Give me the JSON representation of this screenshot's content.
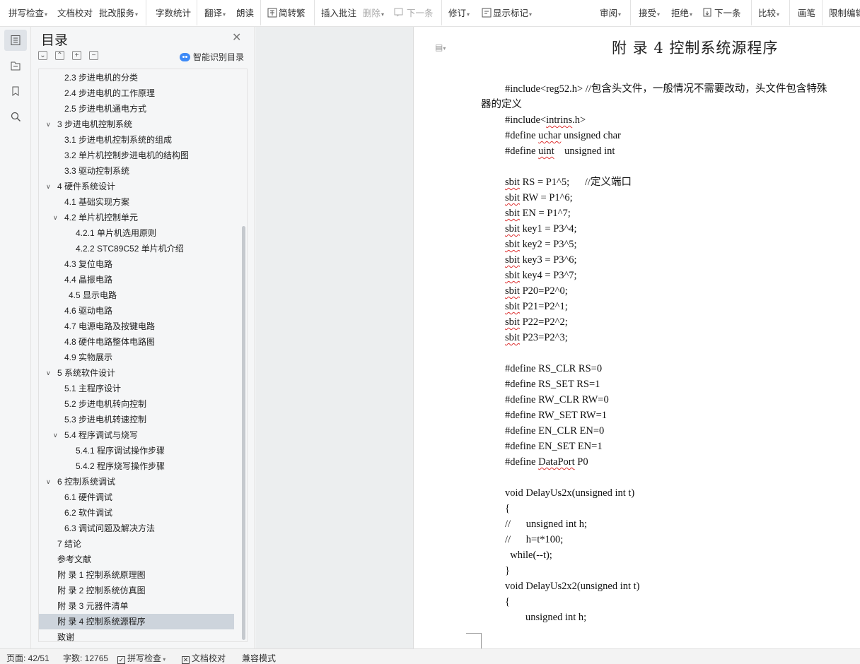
{
  "ribbon": {
    "spell_check": "拼写检查",
    "doc_proofread": "文档校对",
    "review_service": "批改服务",
    "word_count": "字数统计",
    "translate": "翻译",
    "read_aloud": "朗读",
    "simp_trad": "简转繁",
    "insert_comment": "插入批注",
    "delete": "删除",
    "next_comment": "下一条",
    "track_changes": "修订",
    "show_markup": "显示标记",
    "review": "审阅",
    "accept": "接受",
    "reject": "拒绝",
    "next_change": "下一条",
    "compare": "比较",
    "ink": "画笔",
    "restrict_editing": "限制编辑"
  },
  "toc": {
    "title": "目录",
    "smart_identify": "智能识别目录",
    "items": [
      {
        "label": "2.3  步进电机的分类",
        "level": 2
      },
      {
        "label": "2.4  步进电机的工作原理",
        "level": 2
      },
      {
        "label": "2.5  步进电机通电方式",
        "level": 2
      },
      {
        "label": "3    步进电机控制系统",
        "level": 1,
        "expanded": true
      },
      {
        "label": "3.1  步进电机控制系统的组成",
        "level": 2
      },
      {
        "label": "3.2 单片机控制步进电机的结构图",
        "level": 2
      },
      {
        "label": "3.3  驱动控制系统",
        "level": 2
      },
      {
        "label": "4    硬件系统设计",
        "level": 1,
        "expanded": true
      },
      {
        "label": "4.1  基础实现方案",
        "level": 2
      },
      {
        "label": "4.2  单片机控制单元",
        "level": 2,
        "expanded": true
      },
      {
        "label": "4.2.1  单片机选用原则",
        "level": 3
      },
      {
        "label": "4.2.2 STC89C52 单片机介绍",
        "level": 3
      },
      {
        "label": "4.3  复位电路",
        "level": 2
      },
      {
        "label": "4.4  晶振电路",
        "level": 2
      },
      {
        "label": "4.5  显示电路",
        "level": 2,
        "indent_extra": true
      },
      {
        "label": "4.6  驱动电路",
        "level": 2
      },
      {
        "label": "4.7  电源电路及按键电路",
        "level": 2
      },
      {
        "label": "4.8  硬件电路整体电路图",
        "level": 2
      },
      {
        "label": "4.9  实物展示",
        "level": 2
      },
      {
        "label": "5    系统软件设计",
        "level": 1,
        "expanded": true
      },
      {
        "label": "5.1  主程序设计",
        "level": 2
      },
      {
        "label": "5.2  步进电机转向控制",
        "level": 2
      },
      {
        "label": "5.3  步进电机转速控制",
        "level": 2
      },
      {
        "label": "5.4  程序调试与烧写",
        "level": 2,
        "expanded": true
      },
      {
        "label": "5.4.1  程序调试操作步骤",
        "level": 3
      },
      {
        "label": "5.4.2  程序烧写操作步骤",
        "level": 3
      },
      {
        "label": "6    控制系统调试",
        "level": 1,
        "expanded": true
      },
      {
        "label": "6.1  硬件调试",
        "level": 2
      },
      {
        "label": "6.2  软件调试",
        "level": 2
      },
      {
        "label": "6.3  调试问题及解决方法",
        "level": 2
      },
      {
        "label": "7    结论",
        "level": 1
      },
      {
        "label": "参考文献",
        "level": 1
      },
      {
        "label": "附    录  1  控制系统原理图",
        "level": 1
      },
      {
        "label": "附    录  2  控制系统仿真图",
        "level": 1
      },
      {
        "label": "附    录  3  元器件清单",
        "level": 1
      },
      {
        "label": "附    录  4  控制系统源程序",
        "level": 1,
        "selected": true
      },
      {
        "label": "致谢",
        "level": 1
      }
    ]
  },
  "document": {
    "title": "附    录  4  控制系统源程序",
    "lines": [
      {
        "text": "#include<reg52.h> //包含头文件，一般情况不需要改动，头文件包含特殊",
        "indent": 1
      },
      {
        "text": "器的定义",
        "indent": 0
      },
      {
        "text": "#include<intrins.h>",
        "indent": 1
      },
      {
        "text": "#define uchar unsigned char",
        "indent": 1
      },
      {
        "text": "#define uint    unsigned int",
        "indent": 1
      },
      {
        "text": "",
        "indent": 1
      },
      {
        "text": "sbit RS = P1^5;      //定义端口",
        "indent": 1
      },
      {
        "text": "sbit RW = P1^6;",
        "indent": 1
      },
      {
        "text": "sbit EN = P1^7;",
        "indent": 1
      },
      {
        "text": "sbit key1 = P3^4;",
        "indent": 1
      },
      {
        "text": "sbit key2 = P3^5;",
        "indent": 1
      },
      {
        "text": "sbit key3 = P3^6;",
        "indent": 1
      },
      {
        "text": "sbit key4 = P3^7;",
        "indent": 1
      },
      {
        "text": "sbit P20=P2^0;",
        "indent": 1
      },
      {
        "text": "sbit P21=P2^1;",
        "indent": 1
      },
      {
        "text": "sbit P22=P2^2;",
        "indent": 1
      },
      {
        "text": "sbit P23=P2^3;",
        "indent": 1
      },
      {
        "text": "",
        "indent": 1
      },
      {
        "text": "#define RS_CLR RS=0",
        "indent": 1
      },
      {
        "text": "#define RS_SET RS=1",
        "indent": 1
      },
      {
        "text": "#define RW_CLR RW=0",
        "indent": 1
      },
      {
        "text": "#define RW_SET RW=1",
        "indent": 1
      },
      {
        "text": "#define EN_CLR EN=0",
        "indent": 1
      },
      {
        "text": "#define EN_SET EN=1",
        "indent": 1
      },
      {
        "text": "#define DataPort P0",
        "indent": 1
      },
      {
        "text": "",
        "indent": 1
      },
      {
        "text": "void DelayUs2x(unsigned int t)",
        "indent": 1
      },
      {
        "text": "{",
        "indent": 1
      },
      {
        "text": "//      unsigned int h;",
        "indent": 1
      },
      {
        "text": "//      h=t*100;",
        "indent": 1
      },
      {
        "text": "  while(--t);",
        "indent": 1
      },
      {
        "text": "}",
        "indent": 1
      },
      {
        "text": "void DelayUs2x2(unsigned int t)",
        "indent": 1
      },
      {
        "text": "{",
        "indent": 1
      },
      {
        "text": "        unsigned int h;",
        "indent": 1
      }
    ]
  },
  "status": {
    "page": "页面: 42/51",
    "word_count": "字数: 12765",
    "spell_check": "拼写检查",
    "doc_proofread": "文档校对",
    "compat_mode": "兼容模式"
  }
}
